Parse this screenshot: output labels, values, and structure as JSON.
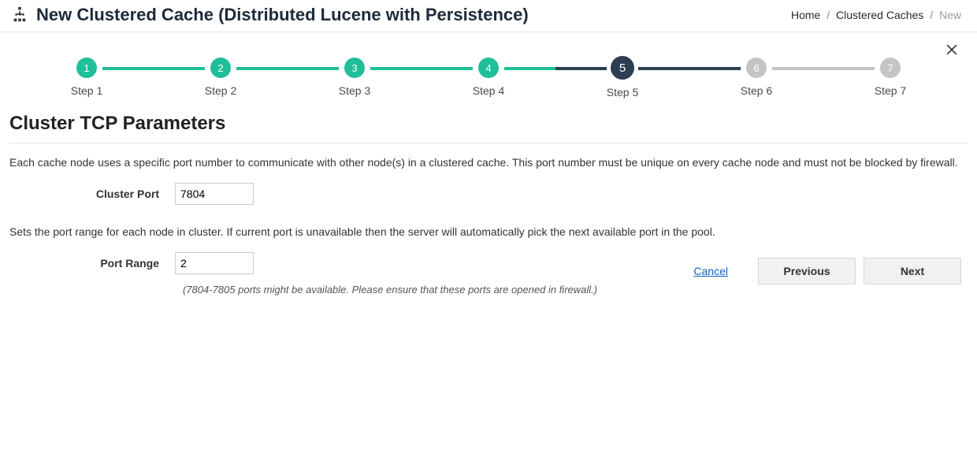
{
  "header": {
    "title": "New Clustered Cache (Distributed Lucene with Persistence)",
    "breadcrumb": {
      "home": "Home",
      "mid": "Clustered Caches",
      "current": "New"
    }
  },
  "steps": {
    "s1": {
      "num": "1",
      "label": "Step 1"
    },
    "s2": {
      "num": "2",
      "label": "Step 2"
    },
    "s3": {
      "num": "3",
      "label": "Step 3"
    },
    "s4": {
      "num": "4",
      "label": "Step 4"
    },
    "s5": {
      "num": "5",
      "label": "Step 5"
    },
    "s6": {
      "num": "6",
      "label": "Step 6"
    },
    "s7": {
      "num": "7",
      "label": "Step 7"
    }
  },
  "section_title": "Cluster TCP Parameters",
  "cluster_port": {
    "desc": "Each cache node uses a specific port number to communicate with other node(s) in a clustered cache. This port number must be unique on every cache node and must not be blocked by firewall.",
    "label": "Cluster Port",
    "value": "7804"
  },
  "port_range": {
    "desc": "Sets the port range for each node in cluster. If current port is unavailable then the server will automatically pick the next available port in the pool.",
    "label": "Port Range",
    "value": "2",
    "hint": "(7804-7805 ports might be available. Please ensure that these ports are opened in firewall.)"
  },
  "footer": {
    "cancel": "Cancel",
    "previous": "Previous",
    "next": "Next"
  }
}
